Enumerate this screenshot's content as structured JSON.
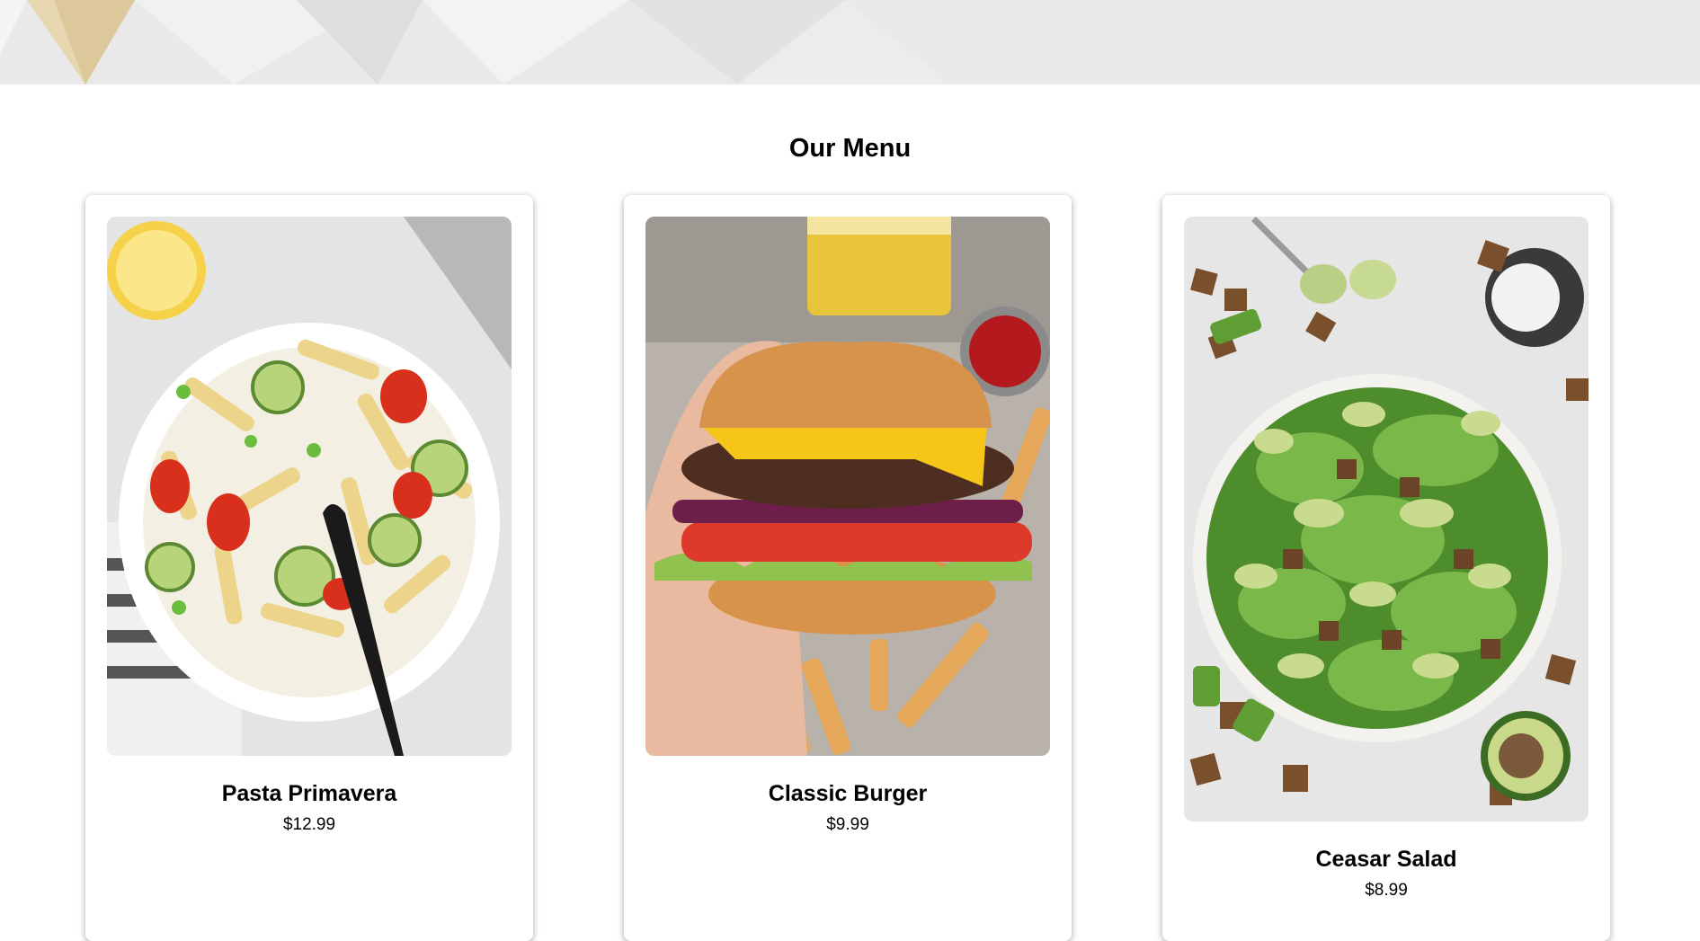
{
  "menu": {
    "title": "Our Menu",
    "items": [
      {
        "name": "Pasta Primavera",
        "price": "$12.99",
        "image": "pasta-primavera-photo"
      },
      {
        "name": "Classic Burger",
        "price": "$9.99",
        "image": "classic-burger-photo"
      },
      {
        "name": "Ceasar Salad",
        "price": "$8.99",
        "image": "caesar-salad-photo"
      }
    ]
  },
  "colors": {
    "background": "#ffffff",
    "hero_strip": "#e8e8e8",
    "hero_accent": "#d9c69a",
    "text": "#000000"
  }
}
